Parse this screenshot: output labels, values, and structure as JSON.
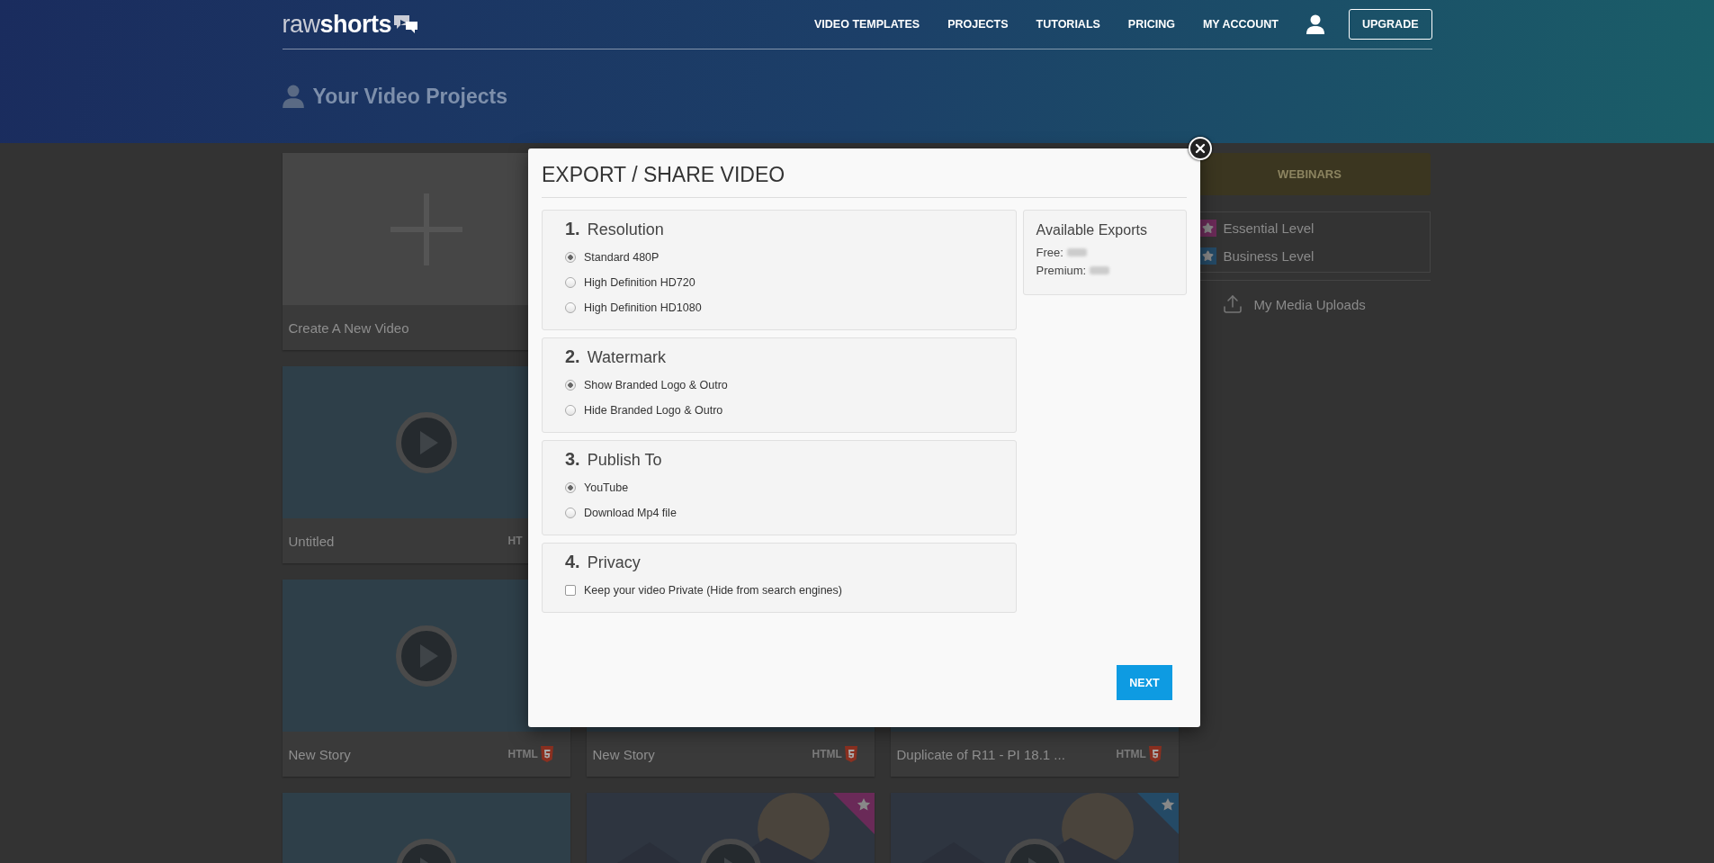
{
  "header": {
    "logo": "raw**shorts**",
    "nav": [
      "VIDEO TEMPLATES",
      "PROJECTS",
      "TUTORIALS",
      "PRICING",
      "MY ACCOUNT"
    ],
    "upgrade": "UPGRADE",
    "page_title": "Your Video Projects"
  },
  "project_rows": [
    {
      "cards": [
        {
          "kind": "new",
          "title": "Create A New Video"
        }
      ]
    },
    {
      "cards": [
        {
          "kind": "video",
          "title": "Untitled",
          "badge": "HT",
          "html5": false
        }
      ]
    },
    {
      "cards": [
        {
          "kind": "video",
          "title": "New Story",
          "badge": "HTML",
          "html5": true
        },
        {
          "kind": "caption",
          "title": "New Story",
          "badge": "HTML",
          "html5": true
        },
        {
          "kind": "caption",
          "title": "Duplicate of R11 - PI 18.1 ...",
          "badge": "HTML",
          "html5": true
        }
      ]
    },
    {
      "cards": [
        {
          "kind": "video"
        },
        {
          "kind": "picture",
          "color": "#6a2a58"
        },
        {
          "kind": "picture",
          "color": "#244a66"
        }
      ]
    }
  ],
  "sidebar": {
    "webinars": "WEBINARS",
    "levels": [
      {
        "label": "Essential Level",
        "color": "#6a2a58"
      },
      {
        "label": "Business Level",
        "color": "#244a66"
      }
    ],
    "uploads": "My Media Uploads"
  },
  "modal": {
    "title": "EXPORT / SHARE VIDEO",
    "sections": [
      {
        "number": "1.",
        "title": "Resolution",
        "kind": "radio",
        "options": [
          {
            "label": "Standard 480P",
            "selected": true
          },
          {
            "label": "High Definition HD720",
            "selected": false
          },
          {
            "label": "High Definition HD1080",
            "selected": false
          }
        ]
      },
      {
        "number": "2.",
        "title": "Watermark",
        "kind": "radio",
        "options": [
          {
            "label": "Show Branded Logo & Outro",
            "selected": true
          },
          {
            "label": "Hide Branded Logo & Outro",
            "selected": false
          }
        ]
      },
      {
        "number": "3.",
        "title": "Publish To",
        "kind": "radio",
        "options": [
          {
            "label": "YouTube",
            "selected": true
          },
          {
            "label": "Download Mp4 file",
            "selected": false
          }
        ]
      },
      {
        "number": "4.",
        "title": "Privacy",
        "kind": "checkbox",
        "options": [
          {
            "label": "Keep your video Private (Hide from search engines)",
            "checked": false
          }
        ]
      }
    ],
    "exports": {
      "title": "Available Exports",
      "lines": [
        "Free:",
        "Premium:"
      ]
    },
    "next": "NEXT"
  }
}
